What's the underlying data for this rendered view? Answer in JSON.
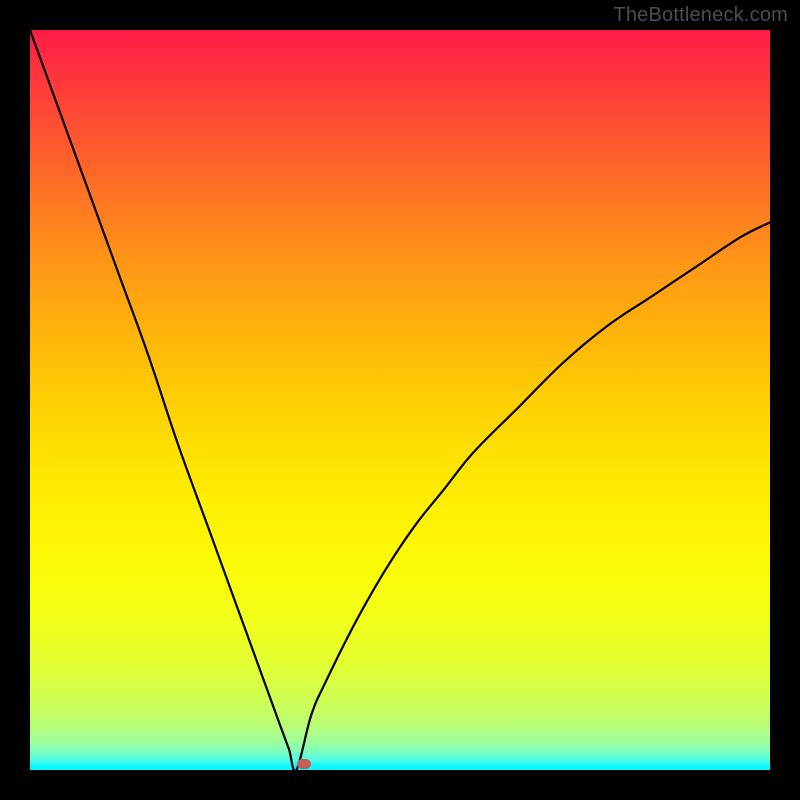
{
  "watermark": "TheBottleneck.com",
  "colors": {
    "page_bg": "#000000",
    "watermark_text": "#4d4d4d",
    "curve_stroke": "#000000",
    "marker_fill": "#c15f55",
    "gradient_top": "#fe1c47",
    "gradient_mid": "#fee702",
    "gradient_bottom": "#0bf9fe"
  },
  "chart_data": {
    "type": "line",
    "title": "",
    "xlabel": "",
    "ylabel": "",
    "x_range": [
      0,
      100
    ],
    "y_range": [
      0,
      100
    ],
    "notes": "V-shaped bottleneck curve with minimum near x≈36. Left branch nearly linear; right branch concave (square-root like). Values are estimated from pixel positions since no axes/ticks are shown.",
    "series": [
      {
        "name": "left_branch",
        "x": [
          0,
          4,
          8,
          12,
          16,
          20,
          24,
          28,
          32,
          34,
          35,
          36
        ],
        "y": [
          100,
          89,
          78,
          67,
          56,
          44,
          33,
          22,
          11,
          5.5,
          2.8,
          0
        ]
      },
      {
        "name": "right_branch",
        "x": [
          36,
          38,
          40,
          44,
          48,
          52,
          56,
          60,
          66,
          72,
          78,
          84,
          90,
          96,
          100
        ],
        "y": [
          0,
          7.4,
          12,
          20,
          27,
          33,
          38,
          43,
          49,
          55,
          60,
          64,
          68,
          72,
          74
        ]
      }
    ],
    "marker": {
      "x": 37,
      "y": 0.8,
      "label": "optimal-point"
    }
  }
}
